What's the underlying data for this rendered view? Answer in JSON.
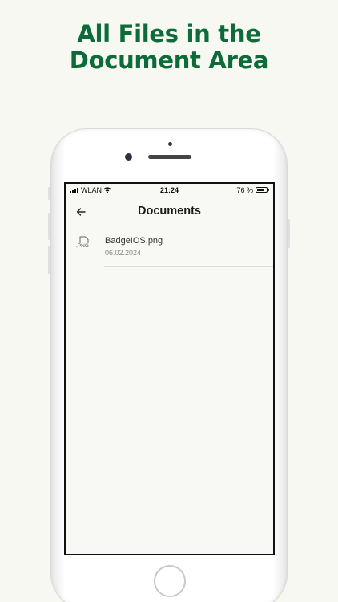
{
  "headline": {
    "line1": "All Files in the",
    "line2": "Document Area"
  },
  "status_bar": {
    "carrier": "WLAN",
    "time": "21:24",
    "battery_percent": "76 %",
    "battery_level": 0.76
  },
  "nav": {
    "title": "Documents",
    "back_icon": "arrow-left-icon"
  },
  "files": [
    {
      "name": "BadgeIOS.png",
      "date": "06.02.2024",
      "ext": ".PNG",
      "icon": "file-icon"
    }
  ],
  "colors": {
    "headline": "#0d6b3a",
    "background": "#f8f8f3"
  }
}
